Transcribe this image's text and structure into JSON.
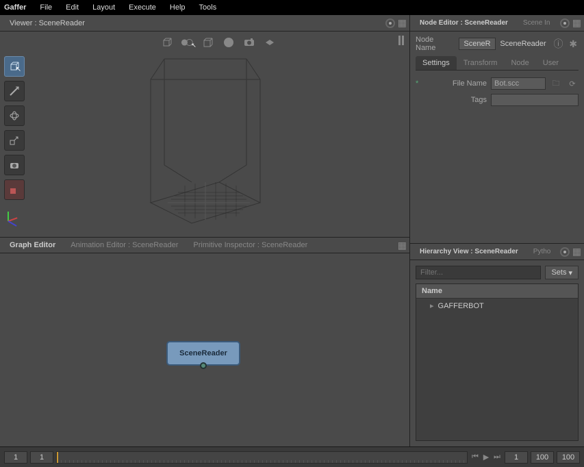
{
  "app": {
    "name": "Gaffer"
  },
  "menu": [
    "File",
    "Edit",
    "Layout",
    "Execute",
    "Help",
    "Tools"
  ],
  "viewer": {
    "title": "Viewer : SceneReader"
  },
  "left_tools": [
    "select",
    "translate",
    "rotate",
    "scale",
    "camera",
    "crop"
  ],
  "graph": {
    "tabs": {
      "graph": "Graph Editor",
      "animation": "Animation Editor : SceneReader",
      "primitive": "Primitive Inspector : SceneReader"
    },
    "node": {
      "label": "SceneReader"
    }
  },
  "node_editor": {
    "title": "Node Editor : SceneReader",
    "scene_in_tab": "Scene In",
    "node_name_label": "Node Name",
    "node_name_value": "SceneReader",
    "display_name": "SceneReader",
    "tabs": [
      "Settings",
      "Transform",
      "Node",
      "User"
    ],
    "file_name_label": "File Name",
    "file_name_value": "Bot.scc",
    "tags_label": "Tags",
    "tags_value": ""
  },
  "hierarchy": {
    "title": "Hierarchy View : SceneReader",
    "python_tab": "Pytho",
    "filter_placeholder": "Filter...",
    "sets_label": "Sets",
    "header": "Name",
    "items": [
      "GAFFERBOT"
    ]
  },
  "timeline": {
    "start": "1",
    "current": "1",
    "play_current": "1",
    "end": "100",
    "range_end": "100"
  }
}
